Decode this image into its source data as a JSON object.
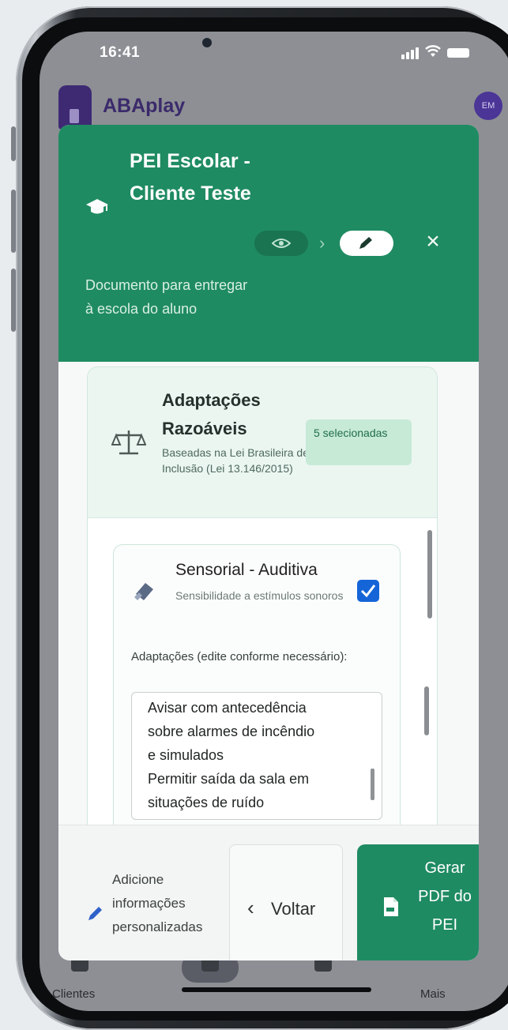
{
  "status_bar": {
    "time": "16:41"
  },
  "app": {
    "name": "ABAplay",
    "avatar": "EM",
    "nav": {
      "clients": "Clientes",
      "sessions": "",
      "programs": "",
      "more": "Mais"
    }
  },
  "modal": {
    "title": "PEI Escolar - Cliente Teste",
    "subtitle": "Documento para entregar à escola do aluno",
    "close": "×"
  },
  "section": {
    "title": "Adaptações Razoáveis",
    "description": "Baseadas na Lei Brasileira de Inclusão (Lei 13.146/2015)",
    "badge": "5 selecionadas"
  },
  "card": {
    "title": "Sensorial - Auditiva",
    "subtitle": "Sensibilidade a estímulos sonoros",
    "checked": true,
    "field_label": "Adaptações (edite conforme necessário):",
    "textarea_value": "Avisar com antecedência\nsobre alarmes de incêndio\ne simulados\nPermitir saída da sala em\nsituações de ruído"
  },
  "footer": {
    "hint": "Adicione informações personalizadas",
    "back_label": "Voltar",
    "pdf_label": "Gerar PDF do PEI"
  },
  "colors": {
    "brand_green": "#1f8b62",
    "checkbox_blue": "#1565d8",
    "app_purple": "#3e2a73"
  }
}
